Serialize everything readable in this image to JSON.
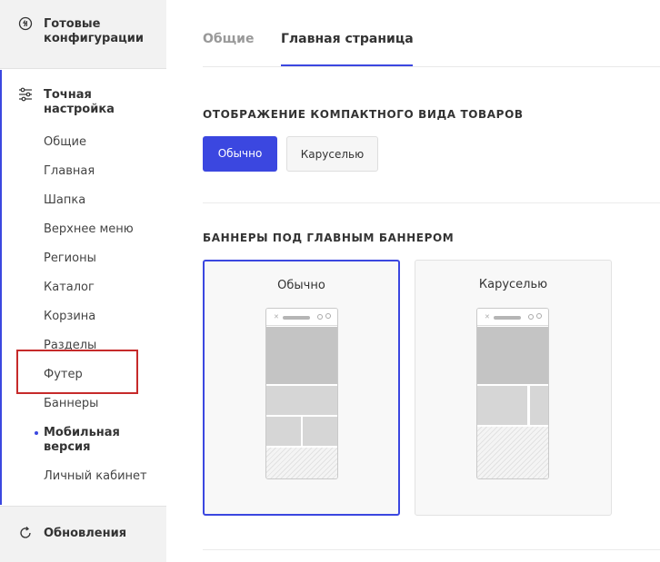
{
  "sidebar": {
    "presets_label": "Готовые конфигурации",
    "fine_tuning_label": "Точная настройка",
    "items": [
      {
        "label": "Общие"
      },
      {
        "label": "Главная"
      },
      {
        "label": "Шапка"
      },
      {
        "label": "Верхнее меню"
      },
      {
        "label": "Регионы"
      },
      {
        "label": "Каталог"
      },
      {
        "label": "Корзина"
      },
      {
        "label": "Разделы"
      },
      {
        "label": "Футер"
      },
      {
        "label": "Баннеры"
      },
      {
        "label": "Мобильная версия"
      },
      {
        "label": "Личный кабинет"
      }
    ],
    "active_item": "Мобильная версия",
    "updates_label": "Обновления"
  },
  "tabs": {
    "general": "Общие",
    "home": "Главная страница",
    "active": "Главная страница"
  },
  "section_compact": {
    "title": "ОТОБРАЖЕНИЕ КОМПАКТНОГО ВИДА ТОВАРОВ",
    "options": [
      "Обычно",
      "Каруселью"
    ],
    "selected": "Обычно"
  },
  "section_banners": {
    "title": "БАННЕРЫ ПОД ГЛАВНЫМ БАННЕРОМ",
    "options": [
      "Обычно",
      "Каруселью"
    ],
    "selected": "Обычно"
  },
  "colors": {
    "accent": "#3b47e0",
    "highlight": "#c62a2a",
    "sidebar_bg": "#f2f2f2"
  },
  "icons": {
    "presets": "circle-arrows-icon",
    "fine_tuning": "sliders-icon",
    "updates": "refresh-icon"
  }
}
